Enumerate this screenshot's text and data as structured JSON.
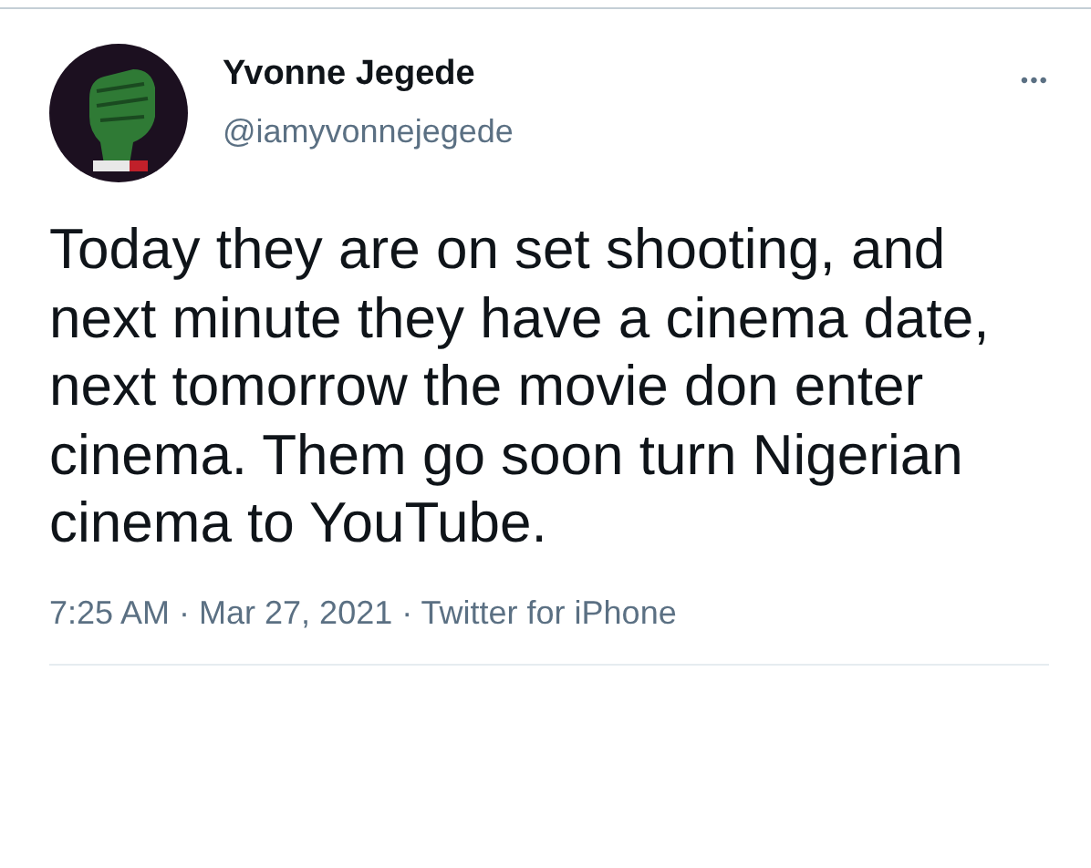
{
  "tweet": {
    "author": {
      "name": "Yvonne Jegede",
      "handle": "@iamyvonnejegede"
    },
    "more_button": "•••",
    "text": "Today they are on set shooting, and next minute they have a cinema date, next tomorrow the movie don enter cinema. Them go soon turn Nigerian cinema to YouTube.",
    "meta": "7:25 AM · Mar 27, 2021 · Twitter for iPhone"
  }
}
